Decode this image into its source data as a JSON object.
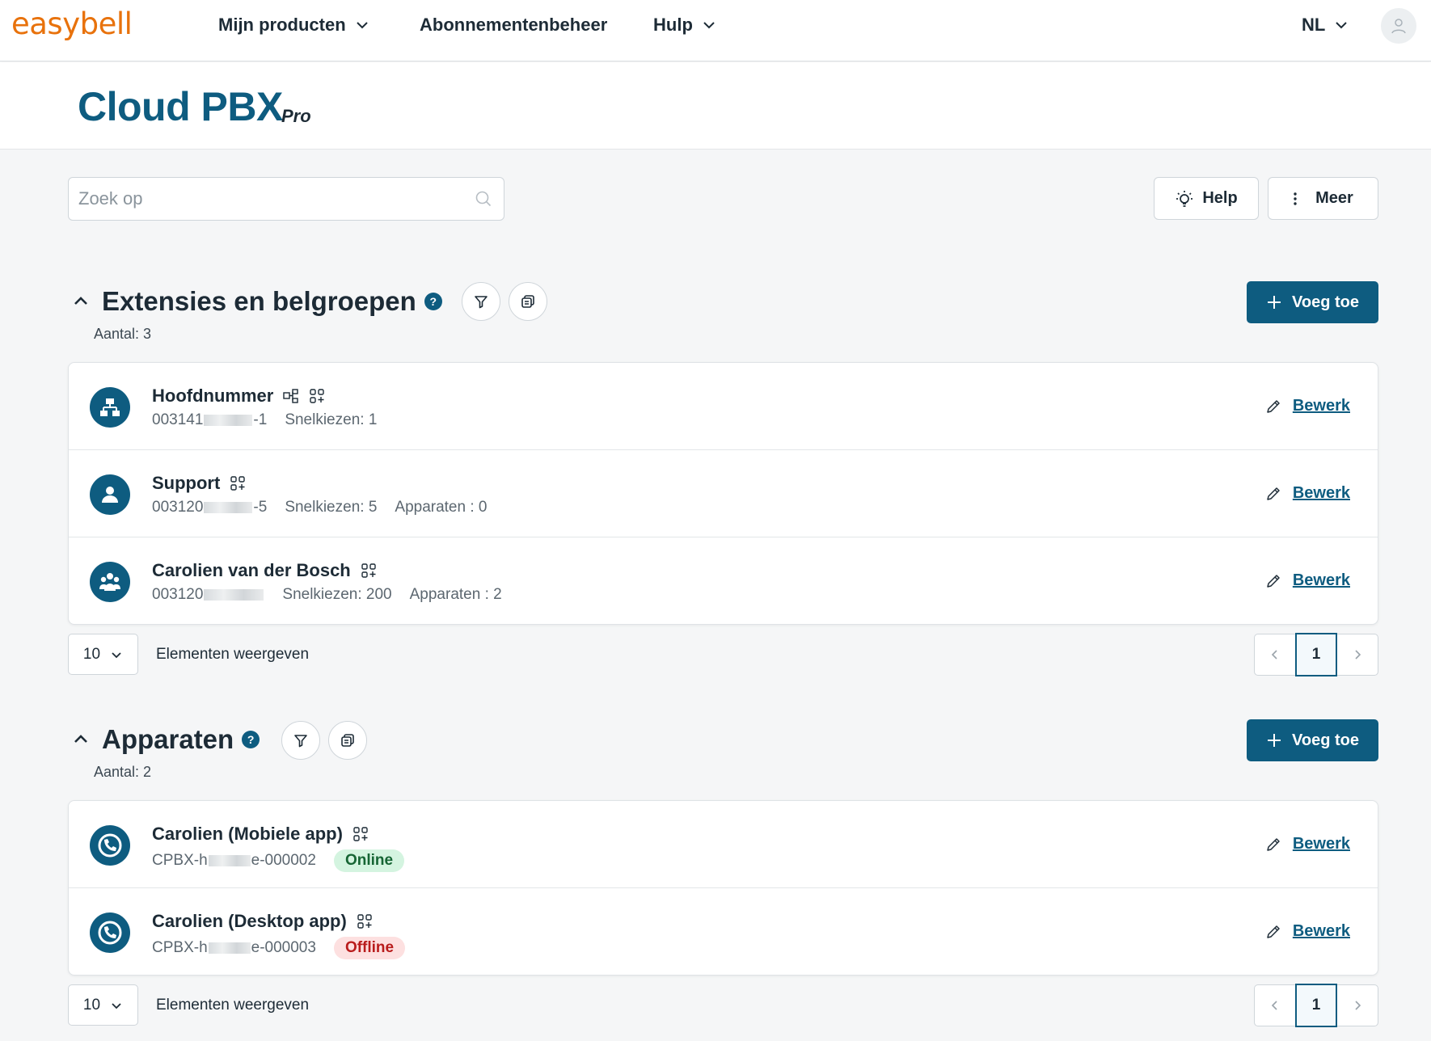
{
  "nav": {
    "logo": "easybell",
    "items": [
      {
        "label": "Mijn producten",
        "has_dropdown": true
      },
      {
        "label": "Abonnementenbeheer",
        "has_dropdown": false
      },
      {
        "label": "Hulp",
        "has_dropdown": true
      }
    ],
    "language": "NL"
  },
  "header": {
    "title": "Cloud PBX",
    "suffix": "Pro"
  },
  "toolbar": {
    "search_placeholder": "Zoek op",
    "help_label": "Help",
    "more_label": "Meer"
  },
  "sections": {
    "extensions": {
      "title": "Extensies en belgroepen",
      "help_mark": "?",
      "count_label": "Aantal: 3",
      "add_label": "Voeg toe",
      "rows": [
        {
          "name": "Hoofdnummer",
          "icon": "hierarchy-icon",
          "number_prefix": "003141",
          "number_suffix": "-1",
          "speed_dial": "Snelkiezen: 1",
          "devices": "",
          "edit_label": "Bewerk"
        },
        {
          "name": "Support",
          "icon": "user-icon",
          "number_prefix": "003120",
          "number_suffix": "-5",
          "speed_dial": "Snelkiezen: 5",
          "devices": "Apparaten : 0",
          "edit_label": "Bewerk"
        },
        {
          "name": "Carolien van der Bosch",
          "icon": "group-icon",
          "number_prefix": "003120",
          "number_suffix": "",
          "speed_dial": "Snelkiezen: 200",
          "devices": "Apparaten : 2",
          "edit_label": "Bewerk"
        }
      ],
      "page_size": "10",
      "page_size_label": "Elementen weergeven",
      "current_page": "1"
    },
    "devices": {
      "title": "Apparaten",
      "help_mark": "?",
      "count_label": "Aantal: 2",
      "add_label": "Voeg toe",
      "rows": [
        {
          "name": "Carolien (Mobiele app)",
          "icon": "phone-icon",
          "id_prefix": "CPBX-h",
          "id_suffix": "e-000002",
          "status": "Online",
          "edit_label": "Bewerk"
        },
        {
          "name": "Carolien (Desktop app)",
          "icon": "phone-icon",
          "id_prefix": "CPBX-h",
          "id_suffix": "e-000003",
          "status": "Offline",
          "edit_label": "Bewerk"
        }
      ],
      "page_size": "10",
      "page_size_label": "Elementen weergeven",
      "current_page": "1"
    }
  },
  "colors": {
    "brand": "#e8720c",
    "primary": "#0e5c80",
    "online_bg": "#d4f4e0",
    "offline_bg": "#fde0e0"
  }
}
